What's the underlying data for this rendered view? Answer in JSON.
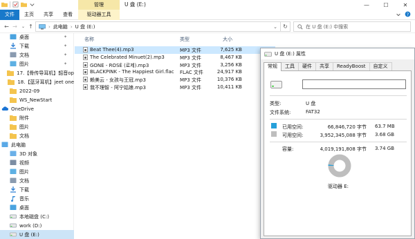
{
  "titlebar": {
    "manage_label": "管理",
    "title": "U 盘 (E:)",
    "min": "—",
    "max": "☐",
    "close": "✕"
  },
  "ribbon": {
    "tabs": [
      "文件",
      "主页",
      "共享",
      "查看",
      "驱动器工具"
    ]
  },
  "address": {
    "crumbs": [
      "此电脑",
      "U 盘 (E:)"
    ],
    "search_placeholder": "在 U 盘 (E:) 中搜索"
  },
  "sidebar": {
    "items": [
      {
        "label": "桌面",
        "icon": "desktop-icon",
        "pinned": true
      },
      {
        "label": "下载",
        "icon": "download-icon",
        "pinned": true
      },
      {
        "label": "文档",
        "icon": "document-icon",
        "pinned": true
      },
      {
        "label": "图片",
        "icon": "picture-icon",
        "pinned": true
      },
      {
        "label": "17.【骨传导耳机】韶音op",
        "icon": "folder-icon",
        "pinned": false
      },
      {
        "label": "18.【蓝牙耳机】jeet one",
        "icon": "folder-icon",
        "pinned": false
      },
      {
        "label": "2022-09",
        "icon": "folder-icon",
        "pinned": false
      },
      {
        "label": "WS_NewStart",
        "icon": "folder-icon",
        "pinned": false
      },
      {
        "label": "OneDrive",
        "icon": "cloud-icon",
        "pinned": false
      },
      {
        "label": "附件",
        "icon": "folder-icon",
        "pinned": false
      },
      {
        "label": "图片",
        "icon": "folder-icon",
        "pinned": false
      },
      {
        "label": "文档",
        "icon": "folder-icon",
        "pinned": false
      },
      {
        "label": "此电脑",
        "icon": "computer-icon",
        "pinned": false
      },
      {
        "label": "3D 对象",
        "icon": "3d-objects-icon",
        "pinned": false
      },
      {
        "label": "视频",
        "icon": "video-icon",
        "pinned": false
      },
      {
        "label": "图片",
        "icon": "picture-icon",
        "pinned": false
      },
      {
        "label": "文档",
        "icon": "document-icon",
        "pinned": false
      },
      {
        "label": "下载",
        "icon": "download-icon",
        "pinned": false
      },
      {
        "label": "音乐",
        "icon": "music-icon",
        "pinned": false
      },
      {
        "label": "桌面",
        "icon": "desktop-icon",
        "pinned": false
      },
      {
        "label": "本地磁盘 (C:)",
        "icon": "disk-icon",
        "pinned": false
      },
      {
        "label": "work (D:)",
        "icon": "disk-icon",
        "pinned": false
      },
      {
        "label": "U 盘 (E:)",
        "icon": "usb-drive-icon",
        "pinned": false
      }
    ]
  },
  "filelist": {
    "headers": {
      "name": "名称",
      "type": "类型",
      "size": "大小"
    },
    "files": [
      {
        "name": "Beat Thee(4).mp3",
        "type": "MP3 文件",
        "size": "7,625 KB"
      },
      {
        "name": "The Celebrated Minuet(2).mp3",
        "type": "MP3 文件",
        "size": "8,467 KB"
      },
      {
        "name": "GONE - ROSÉ (로제).mp3",
        "type": "MP3 文件",
        "size": "3,256 KB"
      },
      {
        "name": "BLACKPINK - The Happiest Girl.flac",
        "type": "FLAC 文件",
        "size": "24,917 KB"
      },
      {
        "name": "赖美云 - 女孩与王冠.mp3",
        "type": "MP3 文件",
        "size": "10,376 KB"
      },
      {
        "name": "我不理智 - 阿宁姑娘.mp3",
        "type": "MP3 文件",
        "size": "10,411 KB"
      }
    ]
  },
  "properties": {
    "title": "U 盘 (E:) 属性",
    "tabs": [
      "常规",
      "工具",
      "硬件",
      "共享",
      "ReadyBoost",
      "自定义"
    ],
    "type_label": "类型:",
    "type_value": "U 盘",
    "fs_label": "文件系统:",
    "fs_value": "FAT32",
    "used_label": "已用空间:",
    "used_bytes": "66,846,720 字节",
    "used_size": "63.7 MB",
    "free_label": "可用空间:",
    "free_bytes": "3,952,345,088 字节",
    "free_size": "3.68 GB",
    "capacity_label": "容量:",
    "capacity_bytes": "4,019,191,808 字节",
    "capacity_size": "3.74 GB",
    "drive_label": "驱动器 E:",
    "used_fraction": 0.0166,
    "colors": {
      "used": "#26a0da",
      "free": "#bebebe"
    }
  }
}
